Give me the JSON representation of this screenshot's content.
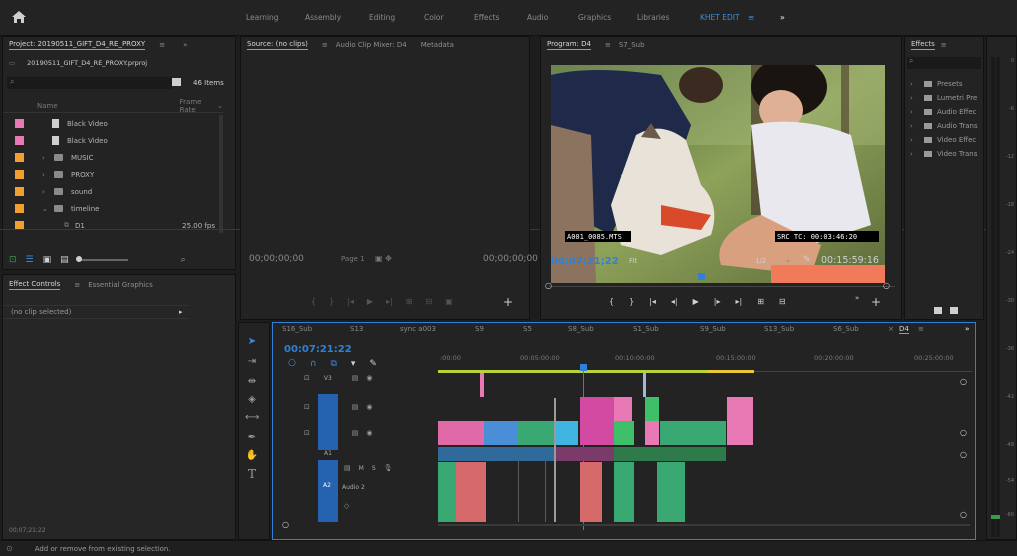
{
  "workspace_tabs": [
    "Learning",
    "Assembly",
    "Editing",
    "Color",
    "Effects",
    "Audio",
    "Graphics",
    "Libraries",
    "KHET EDIT",
    "»"
  ],
  "project": {
    "tab": "Project: 20190511_GIFT_D4_RE_PROXY",
    "file": "20190511_GIFT_D4_RE_PROXY.prproj",
    "items_count": "46 Items",
    "col_name": "Name",
    "col_frame_rate": "Frame Rate",
    "items": [
      {
        "name": "Black Video",
        "color": "#e879b4",
        "kind": "doc",
        "rate": ""
      },
      {
        "name": "Black Video",
        "color": "#e879b4",
        "kind": "doc",
        "rate": ""
      },
      {
        "name": "MUSIC",
        "color": "#f0a030",
        "kind": "folder",
        "rate": ""
      },
      {
        "name": "PROXY",
        "color": "#f0a030",
        "kind": "folder",
        "rate": ""
      },
      {
        "name": "sound",
        "color": "#f0a030",
        "kind": "folder",
        "rate": ""
      },
      {
        "name": "timeline",
        "color": "#f0a030",
        "kind": "folder-open",
        "rate": ""
      },
      {
        "name": "D1",
        "color": "#f0a030",
        "kind": "seq",
        "rate": "25.00 fps"
      }
    ]
  },
  "source": {
    "tabs": [
      "Source: (no clips)",
      "Audio Clip Mixer: D4",
      "Metadata"
    ],
    "tc_left": "00;00;00;00",
    "page": "Page 1",
    "tc_right": "00;00;00;00"
  },
  "effect_controls": {
    "tabs": [
      "Effect Controls",
      "Essential Graphics"
    ],
    "no_clip": "(no clip selected)",
    "bottom_tc": "00;07;21;22"
  },
  "program": {
    "tabs": [
      "Program: D4",
      "S7_Sub"
    ],
    "overlay_left": "A001_0085.MTS",
    "overlay_right": "SRC TC: 00:03:46:20",
    "tc": "00;07;21;22",
    "fit": "Fit",
    "res": "1/2",
    "duration": "00:15:59:16"
  },
  "effects": {
    "tab": "Effects",
    "items": [
      "Presets",
      "Lumetri Pre",
      "Audio Effec",
      "Audio Trans",
      "Video Effec",
      "Video Trans"
    ]
  },
  "timeline": {
    "tabs": [
      "S16_Sub",
      "S13",
      "sync a003",
      "S9",
      "S5",
      "S8_Sub",
      "S1_Sub",
      "S9_Sub",
      "S13_Sub",
      "S6_Sub",
      "D4"
    ],
    "tc": "00:07:21:22",
    "ruler": [
      ":00:00",
      "00:05:00:00",
      "00:10:00:00",
      "00:15:00:00",
      "00:20:00:00",
      "00:25:00:00"
    ],
    "tracks": [
      "V3",
      "V2",
      "V1",
      "A1",
      "A2"
    ],
    "audio_label": "Audio 2",
    "mute": "M",
    "solo": "S"
  },
  "meter_scale": [
    "0",
    "-6",
    "-12",
    "-18",
    "-24",
    "-30",
    "-36",
    "-42",
    "-48",
    "-54",
    "-60"
  ],
  "status": "Add or remove from existing selection."
}
